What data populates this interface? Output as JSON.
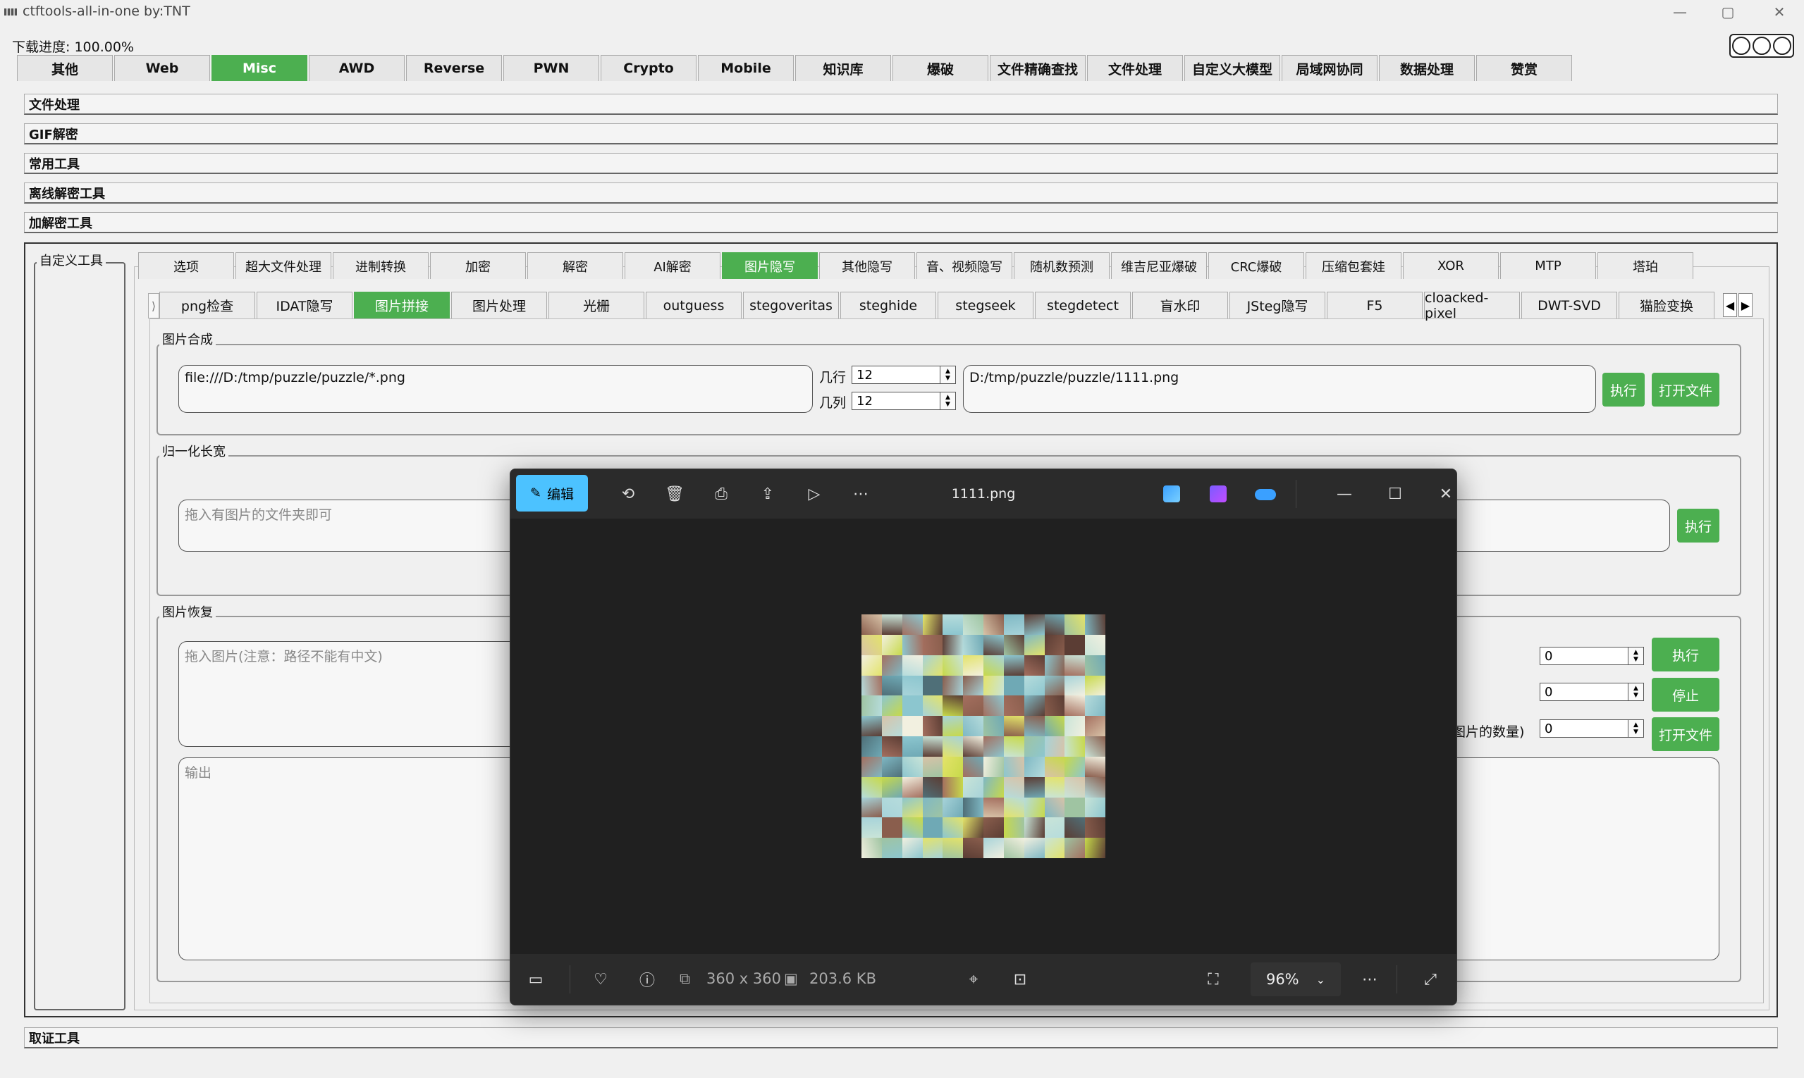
{
  "window": {
    "title": "ctftools-all-in-one   by:TNT",
    "minimize": "—",
    "restore": "▢",
    "close": "✕"
  },
  "download_progress": "下载进度: 100.00%",
  "main_tabs": [
    "其他",
    "Web",
    "Misc",
    "AWD",
    "Reverse",
    "PWN",
    "Crypto",
    "Mobile",
    "知识库",
    "爆破",
    "文件精确查找",
    "文件处理",
    "自定义大模型",
    "局域网协同",
    "数据处理",
    "赞赏"
  ],
  "main_tabs_active": 2,
  "sections": [
    "文件处理",
    "GIF解密",
    "常用工具",
    "离线解密工具",
    "加解密工具"
  ],
  "bottom_section": "取证工具",
  "custom_tools_label": "自定义工具",
  "sub_tabs": [
    "选项",
    "超大文件处理",
    "进制转换",
    "加密",
    "解密",
    "AI解密",
    "图片隐写",
    "其他隐写",
    "音、视频隐写",
    "随机数预测",
    "维吉尼亚爆破",
    "CRC爆破",
    "压缩包套娃",
    "XOR",
    "MTP",
    "塔珀"
  ],
  "sub_tabs_active": 6,
  "subsub_tabs": [
    "png检查",
    "IDAT隐写",
    "图片拼接",
    "图片处理",
    "光栅",
    "outguess",
    "stegoveritas",
    "steghide",
    "stegseek",
    "stegdetect",
    "盲水印",
    "JSteg隐写",
    "F5",
    "cloacked-pixel",
    "DWT-SVD",
    "猫脸变换"
  ],
  "subsub_tabs_active": 2,
  "compose": {
    "title": "图片合成",
    "input_path": "file:///D:/tmp/puzzle/puzzle/*.png",
    "rows_label": "几行",
    "rows_value": "12",
    "cols_label": "几列",
    "cols_value": "12",
    "output_path": "D:/tmp/puzzle/puzzle/1111.png",
    "run": "执行",
    "open": "打开文件"
  },
  "normalize": {
    "title": "归一化长宽",
    "placeholder": "拖入有图片的文件夹即可",
    "run": "执行"
  },
  "restore": {
    "title": "图片恢复",
    "placeholder": "拖入图片(注意：路径不能有中文)",
    "output_placeholder": "输出",
    "label2_tail": ")",
    "label3_tail": "图片的数量)",
    "spin1": "0",
    "spin2": "0",
    "spin3": "0",
    "run": "执行",
    "stop": "停止",
    "open": "打开文件"
  },
  "viewer": {
    "edit": "编辑",
    "filename": "1111.png",
    "dimensions": "360 x 360",
    "filesize": "203.6 KB",
    "zoom": "96%",
    "icons": [
      "rotate-icon",
      "delete-icon",
      "print-icon",
      "share-icon",
      "slideshow-icon",
      "more-icon"
    ]
  },
  "colors": {
    "accent_green": "#4caf50",
    "viewer_bg": "#202020",
    "edit_blue": "#4cc2ff"
  }
}
